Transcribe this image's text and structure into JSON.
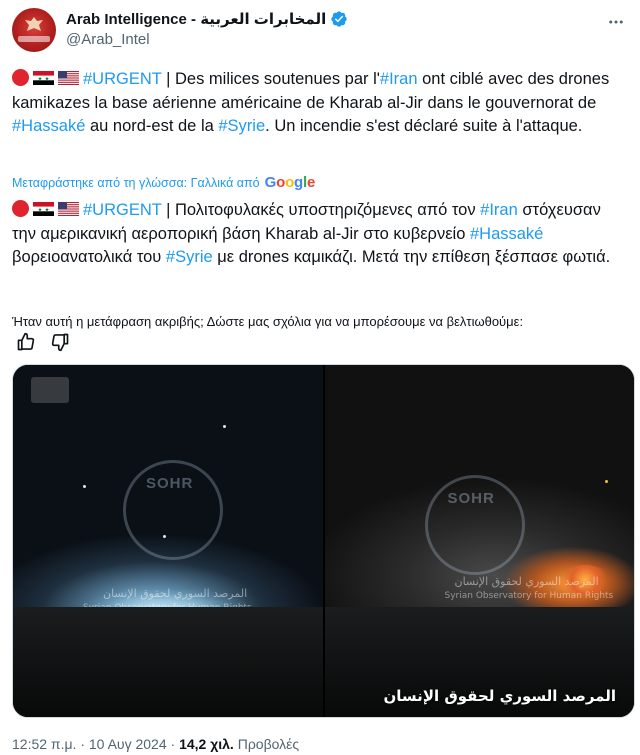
{
  "header": {
    "display_name": "Arab Intelligence - المخابرات العربية",
    "handle": "@Arab_Intel",
    "avatar_icon": "eagle-emblem-icon",
    "verified_icon": "verified-badge-icon",
    "more_icon": "more-horizontal-icon",
    "verified_color": "#1d9bf0"
  },
  "original_text": {
    "prefix_icons": [
      "red-circle-icon",
      "syria-flag-icon",
      "us-flag-icon"
    ],
    "hashtag_urgent": "#URGENT",
    "part1": " | Des milices soutenues par l'",
    "hashtag_iran": "#Iran",
    "part2": " ont ciblé avec des drones kamikazes la base aérienne américaine de Kharab al-Jir dans le gouvernorat de ",
    "hashtag_hassake": "#Hassaké",
    "part3": " au nord-est de la ",
    "hashtag_syrie": "#Syrie",
    "part4": ". Un incendie s'est déclaré suite à l'attaque."
  },
  "translation_notice": {
    "label": "Μεταφράστηκε από τη γλώσσα: Γαλλικά από",
    "provider": "Google"
  },
  "translated_text": {
    "hashtag_urgent": "#URGENT",
    "part1": " | Πολιτοφυλακές υποστηριζόμενες από τον ",
    "hashtag_iran": "#Iran",
    "part2": " στόχευσαν την αμερικανική αεροπορική βάση Kharab al-Jir στο κυβερνείο ",
    "hashtag_hassake": "#Hassaké",
    "part3": " βορειοανατολικά του ",
    "hashtag_syrie": "#Syrie",
    "part4": " με drones καμικάζι. Μετά την επίθεση ξέσπασε φωτιά."
  },
  "feedback": {
    "question": "Ήταν αυτή η μετάφραση ακριβής; Δώστε μας σχόλια για να μπορέσουμε να βελτιωθούμε:",
    "thumbs_up_icon": "thumbs-up-icon",
    "thumbs_down_icon": "thumbs-down-icon"
  },
  "media": {
    "left": {
      "watermark": "SOHR",
      "watermark_ar": "المرصد السوري لحقوق الإنسان",
      "watermark_en": "Syrian Observatory for Human Rights"
    },
    "right": {
      "watermark": "SOHR",
      "watermark_ar": "المرصد السوري لحقوق الإنسان",
      "watermark_en": "Syrian Observatory for Human Rights",
      "caption": "المرصد السوري لحقوق الإنسان"
    }
  },
  "footer": {
    "time": "12:52 π.μ.",
    "separator": " · ",
    "date": "10 Αυγ 2024",
    "views_count": "14,2 χιλ.",
    "views_label": " Προβολές"
  }
}
